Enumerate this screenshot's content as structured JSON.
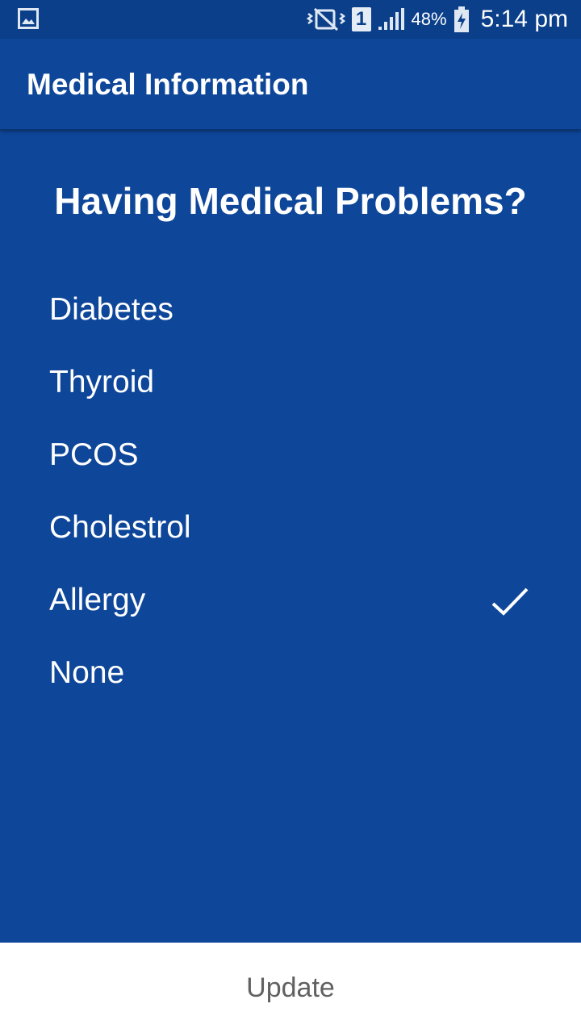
{
  "status_bar": {
    "left_icon": "gallery-icon",
    "right_icons": [
      "vibrate-mute-icon",
      "sim-slot-icon",
      "signal-icon",
      "battery-charging-icon"
    ],
    "sim_number": "1",
    "battery_percent": "48%",
    "time": "5:14 pm"
  },
  "app_bar": {
    "title": "Medical Information"
  },
  "question": "Having Medical Problems?",
  "options": [
    {
      "label": "Diabetes",
      "checked": false
    },
    {
      "label": "Thyroid",
      "checked": false
    },
    {
      "label": "PCOS",
      "checked": false
    },
    {
      "label": "Cholestrol",
      "checked": false
    },
    {
      "label": "Allergy",
      "checked": true
    },
    {
      "label": "None",
      "checked": false
    }
  ],
  "update_button": {
    "label": "Update"
  },
  "colors": {
    "background": "#0e4699",
    "status_bar": "#0b3f8a",
    "text": "#ffffff",
    "button_bar": "#ffffff",
    "button_text": "#616161"
  }
}
